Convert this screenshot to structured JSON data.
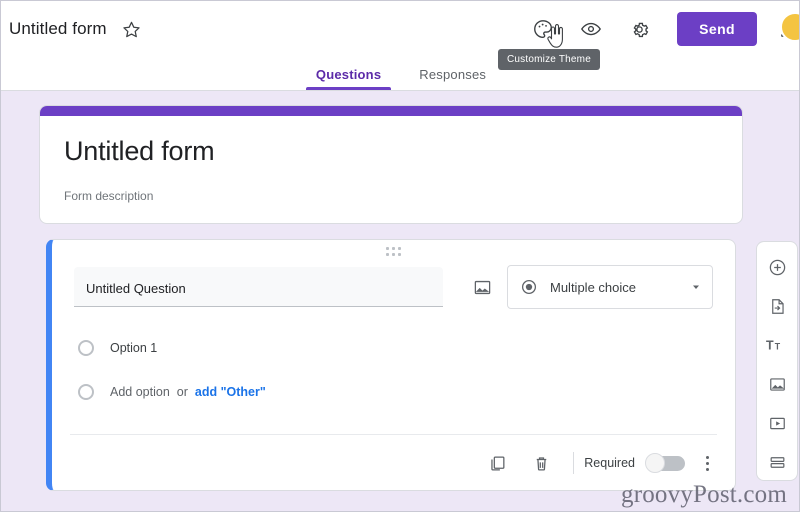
{
  "topbar": {
    "form_title": "Untitled form",
    "star_icon": "star-outline-icon",
    "theme_icon": "palette-icon",
    "preview_icon": "eye-icon",
    "settings_icon": "gear-icon",
    "send_label": "Send",
    "more_icon": "kebab-menu-icon",
    "avatar": "user-avatar",
    "tooltip": "Customize Theme",
    "cursor": "pointer-hand-cursor"
  },
  "tabs": [
    {
      "label": "Questions",
      "active": true
    },
    {
      "label": "Responses",
      "active": false
    }
  ],
  "header_card": {
    "title": "Untitled form",
    "description": "Form description",
    "accent_color": "#6C3FC5"
  },
  "question_card": {
    "accent_color": "#4285F4",
    "drag_handle": "drag-handle-icon",
    "question_text": "Untitled Question",
    "image_icon": "add-image-icon",
    "type_icon": "radio-selected-icon",
    "type_label": "Multiple choice",
    "dropdown_icon": "chevron-down-icon",
    "options": [
      {
        "label": "Option 1"
      }
    ],
    "add_option_label": "Add option",
    "or_label": "or",
    "add_other_label": "add \"Other\"",
    "footer": {
      "duplicate_icon": "copy-icon",
      "delete_icon": "trash-icon",
      "required_label": "Required",
      "required_on": false,
      "more_icon": "kebab-menu-icon"
    }
  },
  "side_toolbar": [
    {
      "icon": "add-question-icon"
    },
    {
      "icon": "import-questions-icon"
    },
    {
      "icon": "add-title-description-icon"
    },
    {
      "icon": "add-image-icon"
    },
    {
      "icon": "add-video-icon"
    },
    {
      "icon": "add-section-icon"
    }
  ],
  "watermark": "groovyPost.com"
}
